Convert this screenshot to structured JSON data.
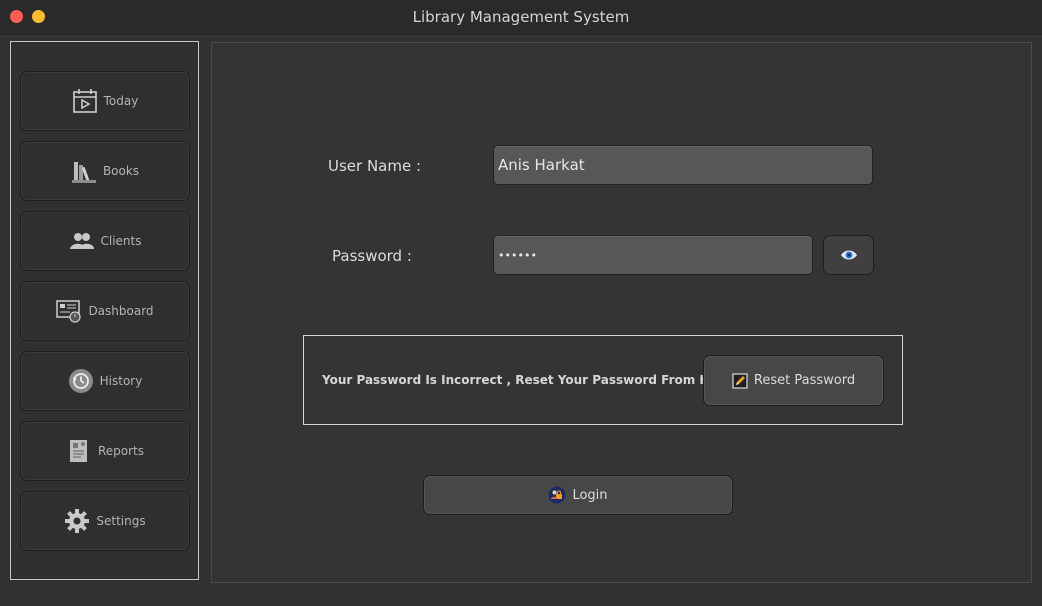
{
  "window": {
    "title": "Library Management System"
  },
  "sidebar": {
    "items": [
      {
        "label": "Today",
        "icon": "calendar-icon"
      },
      {
        "label": "Books",
        "icon": "books-icon"
      },
      {
        "label": "Clients",
        "icon": "clients-icon"
      },
      {
        "label": "Dashboard",
        "icon": "dashboard-icon"
      },
      {
        "label": "History",
        "icon": "history-icon"
      },
      {
        "label": "Reports",
        "icon": "reports-icon"
      },
      {
        "label": "Settings",
        "icon": "gear-icon"
      }
    ]
  },
  "login": {
    "username_label": "User Name :",
    "username_value": "Anis Harkat",
    "password_label": "Password :",
    "password_value": "••••••",
    "reset_message": "Your Password Is Incorrect , Reset Your Password From Here :",
    "reset_button": "Reset Password",
    "login_button": "Login"
  }
}
